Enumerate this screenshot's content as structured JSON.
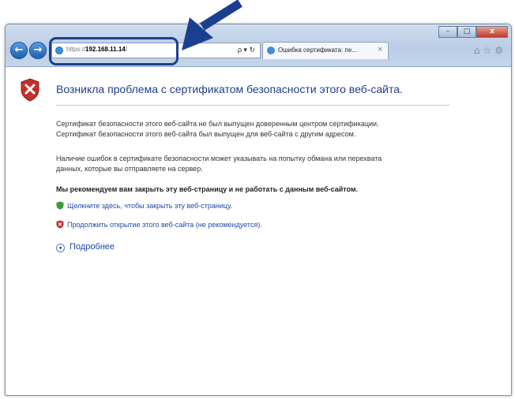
{
  "browser": {
    "address": {
      "protocol": "https://",
      "host": "192.168.11.14",
      "trail": "/",
      "tools": "ρ ▾ ↻"
    },
    "tab": {
      "label": "Ошибка сертификата: пе...",
      "close": "×"
    },
    "window_controls": {
      "minimize": "–",
      "maximize": "□",
      "close": "x"
    },
    "nav": {
      "back": "←",
      "forward": "→"
    },
    "toolbar_icons": "⌂☆⚙"
  },
  "page": {
    "heading": "Возникла проблема с сертификатом безопасности этого веб-сайта.",
    "para1": [
      "Сертификат безопасности этого веб-сайта не был выпущен доверенным центром сертификации.",
      "Сертификат безопасности этого веб-сайта был выпущен для веб-сайта с другим адресом."
    ],
    "para2": [
      "Наличие ошибок в сертификате безопасности может указывать на попытку обмана или перехвата",
      "данных, которые вы отправляете на сервер."
    ],
    "recommendation": "Мы рекомендуем вам закрыть эту веб-страницу и не работать с данным веб-сайтом.",
    "close_link": "Щелкните здесь, чтобы закрыть эту веб-страницу.",
    "continue_link": "Продолжить открытие этого веб-сайта (не рекомендуется).",
    "more_info": "Подробнее"
  },
  "colors": {
    "heading": "#1f3e8a",
    "link": "#1f4aa6",
    "annotation": "#1a3f8f",
    "shield_red": "#c4302b",
    "shield_green": "#3c9a3c"
  }
}
